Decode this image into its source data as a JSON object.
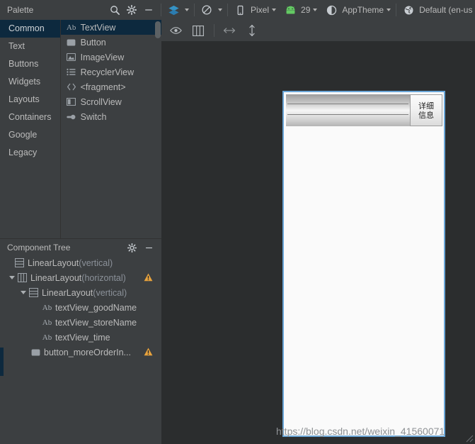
{
  "palette": {
    "title": "Palette",
    "header_icons": [
      "search-icon",
      "gear-icon",
      "minimize-icon"
    ],
    "groups": [
      {
        "label": "Common",
        "selected": true
      },
      {
        "label": "Text",
        "selected": false
      },
      {
        "label": "Buttons",
        "selected": false
      },
      {
        "label": "Widgets",
        "selected": false
      },
      {
        "label": "Layouts",
        "selected": false
      },
      {
        "label": "Containers",
        "selected": false
      },
      {
        "label": "Google",
        "selected": false
      },
      {
        "label": "Legacy",
        "selected": false
      }
    ],
    "items": [
      {
        "label": "TextView",
        "icon": "textview-icon",
        "selected": true
      },
      {
        "label": "Button",
        "icon": "button-icon",
        "selected": false
      },
      {
        "label": "ImageView",
        "icon": "imageview-icon",
        "selected": false
      },
      {
        "label": "RecyclerView",
        "icon": "recyclerview-icon",
        "selected": false
      },
      {
        "label": "<fragment>",
        "icon": "fragment-icon",
        "selected": false
      },
      {
        "label": "ScrollView",
        "icon": "scrollview-icon",
        "selected": false
      },
      {
        "label": "Switch",
        "icon": "switch-icon",
        "selected": false
      }
    ]
  },
  "toolbar": {
    "minimize_label": "—",
    "design_mode": {
      "icon": "layers-icon",
      "label": ""
    },
    "orientation": {
      "icon": "rotate-icon",
      "label": ""
    },
    "device": {
      "icon": "phone-icon",
      "label": "Pixel"
    },
    "api": {
      "icon": "android-icon",
      "label": "29"
    },
    "theme": {
      "icon": "theme-icon",
      "label": "AppTheme"
    },
    "locale": {
      "icon": "globe-icon",
      "label": "Default (en-us"
    }
  },
  "canvas_toolbar": {
    "buttons": [
      {
        "name": "eye-icon",
        "label": ""
      },
      {
        "name": "columns-icon",
        "label": ""
      },
      {
        "name": "width-arrow-icon",
        "label": ""
      },
      {
        "name": "height-arrow-icon",
        "label": ""
      }
    ]
  },
  "component_tree": {
    "title": "Component Tree",
    "header_icons": [
      "gear-icon",
      "minimize-icon"
    ],
    "nodes": [
      {
        "label": "LinearLayout",
        "suffix": "(vertical)",
        "icon": "linearlayout-vertical-icon",
        "indent": 0,
        "arrow": false,
        "warning": false
      },
      {
        "label": "LinearLayout",
        "suffix": "(horizontal)",
        "icon": "linearlayout-horizontal-icon",
        "indent": 1,
        "arrow": true,
        "warning": true
      },
      {
        "label": "LinearLayout",
        "suffix": "(vertical)",
        "icon": "linearlayout-vertical-icon",
        "indent": 2,
        "arrow": true,
        "warning": false
      },
      {
        "label": "textView_goodName",
        "suffix": "",
        "icon": "textview-icon",
        "indent": 3,
        "arrow": false,
        "warning": false
      },
      {
        "label": "textView_storeName",
        "suffix": "",
        "icon": "textview-icon",
        "indent": 3,
        "arrow": false,
        "warning": false
      },
      {
        "label": "textView_time",
        "suffix": "",
        "icon": "textview-icon",
        "indent": 3,
        "arrow": false,
        "warning": false
      },
      {
        "label": "button_moreOrderIn...",
        "suffix": "",
        "icon": "button-icon",
        "indent": 2,
        "arrow": false,
        "warning": true
      }
    ]
  },
  "preview": {
    "detail_button_line1": "详细",
    "detail_button_line2": "信息",
    "text_rows": [
      "",
      "",
      ""
    ]
  },
  "watermark": {
    "text": "https://blog.csdn.net/weixin_41560071"
  },
  "colors": {
    "panel_bg": "#3c3f41",
    "canvas_bg": "#2b2d2e",
    "selection_bg": "#0d293e",
    "accent_blue": "#6ba7d8",
    "warning_amber": "#e8a33d",
    "text": "#bbbbbb"
  }
}
